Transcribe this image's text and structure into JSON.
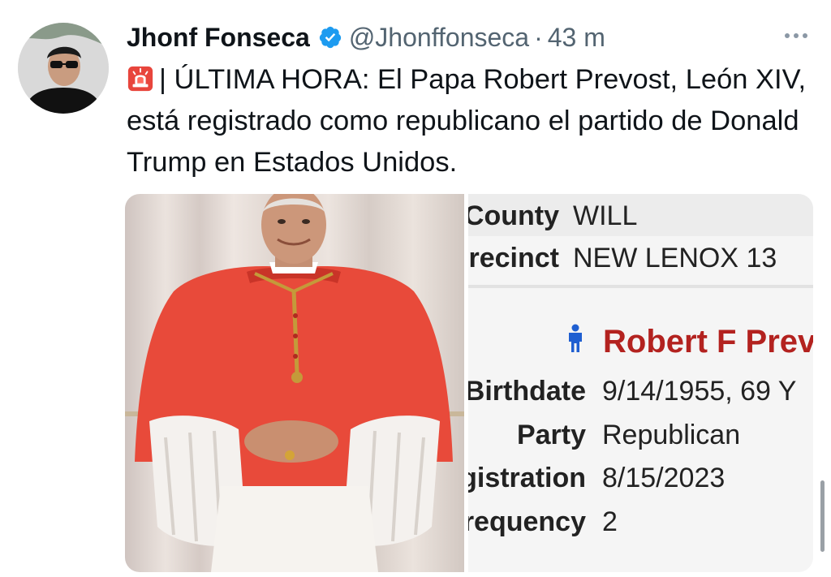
{
  "tweet": {
    "display_name": "Jhonf Fonseca",
    "handle": "@Jhonffonseca",
    "separator": "·",
    "time": "43 m",
    "text_after_emoji": "| ÚLTIMA HORA: El Papa Robert Prevost, León XIV, está registrado como republicano el partido de Donald Trump en Estados Unidos.",
    "emoji_icon": "police-siren-icon",
    "verified_badge_color": "#1d9bf0"
  },
  "media": {
    "left_image": "cardinal-portrait",
    "voter_record": {
      "county_label": "County",
      "county_value": "WILL",
      "precinct_label": "Precinct",
      "precinct_value": "NEW LENOX 13",
      "name": "Robert F Prevost",
      "birthdate_label": "Birthdate",
      "birthdate_value": "9/14/1955, 69 Y",
      "party_label": "Party",
      "party_value": "Republican",
      "registration_label": "Registration",
      "registration_value": "8/15/2023",
      "frequency_label": "Frequency",
      "frequency_value": "2",
      "name_color": "#b3221f",
      "icon_color": "#1f5fd1"
    }
  }
}
